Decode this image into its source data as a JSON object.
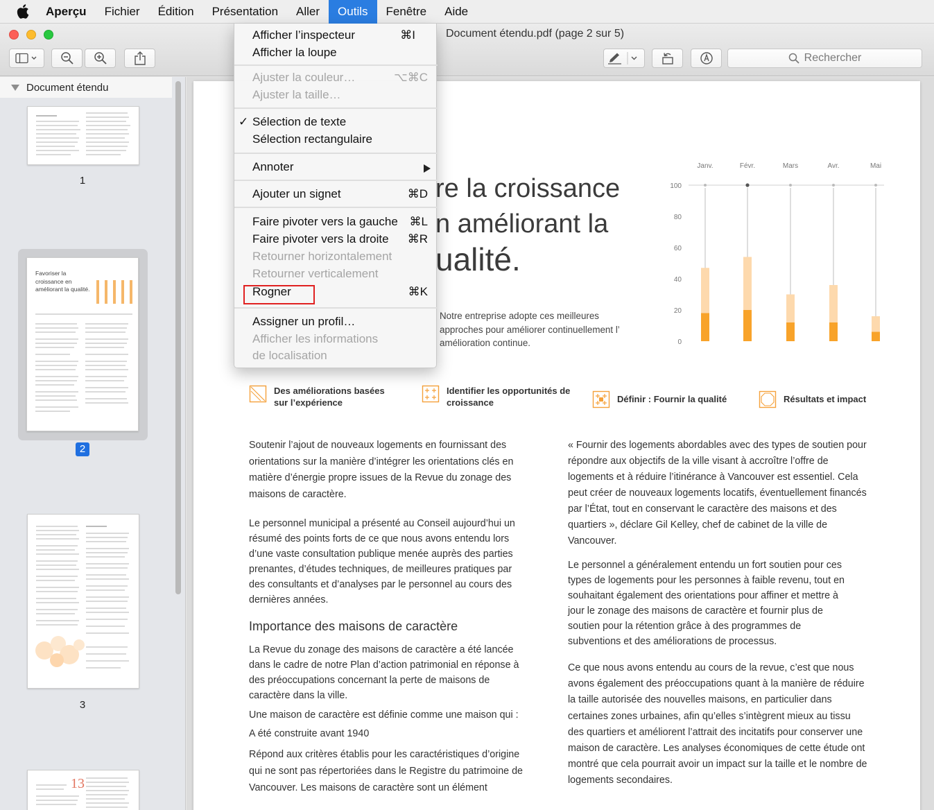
{
  "menubar": {
    "app": "Aperçu",
    "items": [
      "Fichier",
      "Édition",
      "Présentation",
      "Aller",
      "Outils",
      "Fenêtre",
      "Aide"
    ],
    "active_item": "Outils"
  },
  "window": {
    "title": "Document étendu.pdf (page 2 sur 5)",
    "search_placeholder": "Rechercher"
  },
  "sidebar": {
    "header": "Document étendu",
    "pages": [
      "1",
      "2",
      "3"
    ],
    "selected_page": "2",
    "thumb2_title": "Favoriser la croissance en améliorant la qualité.",
    "thumb4_number": "13"
  },
  "tools_menu": {
    "items": [
      {
        "label": "Afficher l’inspecteur",
        "shortcut": "⌘I"
      },
      {
        "label": "Afficher la loupe",
        "shortcut": ""
      },
      {
        "label": "Ajuster la couleur…",
        "shortcut": "⌥⌘C",
        "disabled": true
      },
      {
        "label": "Ajuster la taille…",
        "shortcut": "",
        "disabled": true
      },
      {
        "label": "Sélection de texte",
        "shortcut": "",
        "checked": true
      },
      {
        "label": "Sélection rectangulaire",
        "shortcut": ""
      },
      {
        "label": "Annoter",
        "shortcut": "",
        "submenu": true
      },
      {
        "label": "Ajouter un signet",
        "shortcut": "⌘D"
      },
      {
        "label": "Faire pivoter vers la gauche",
        "shortcut": "⌘L"
      },
      {
        "label": "Faire pivoter vers la droite",
        "shortcut": "⌘R"
      },
      {
        "label": "Retourner horizontalement",
        "shortcut": "",
        "disabled": true
      },
      {
        "label": "Retourner verticalement",
        "shortcut": "",
        "disabled": true
      },
      {
        "label": "Rogner",
        "shortcut": "⌘K",
        "highlighted": true
      },
      {
        "label": "Assigner un profil…",
        "shortcut": ""
      },
      {
        "label": "Afficher les informations",
        "shortcut": "",
        "disabled": true
      },
      {
        "label": "de localisation",
        "shortcut": "",
        "disabled": true
      }
    ],
    "checkmark": "✓"
  },
  "document": {
    "headline_lines": [
      "re la croissance",
      "n améliorant la",
      "ualité."
    ],
    "intro": "Notre entreprise adopte ces meilleures approches pour améliorer continuellement l’ amélioration continue.",
    "features": [
      {
        "label": "Des améliorations basées sur l’expérience"
      },
      {
        "label": "Identifier les opportunités de croissance"
      },
      {
        "label": "Définir : Fournir la qualité"
      },
      {
        "label": "Résultats et impact"
      }
    ],
    "left_column": {
      "p1": "Soutenir l’ajout de nouveaux logements en fournissant des orientations sur la manière d’intégrer les orientations clés en matière d’énergie propre issues de la Revue du zonage des maisons de caractère.",
      "p2": "Le personnel municipal a présenté au Conseil aujourd’hui un résumé des points forts de ce que nous avons entendu lors d’une vaste consultation publique menée auprès des parties prenantes, d’études techniques, de meilleures pratiques par des consultants et d’analyses par le personnel au cours des dernières années.",
      "heading": "Importance des maisons de caractère",
      "p3": "La Revue du zonage des maisons de caractère a été lancée dans le cadre de notre Plan d’action patrimonial en réponse à des préoccupations concernant la perte de maisons de caractère dans la ville.",
      "p4": "Une maison de caractère est définie comme une maison qui :",
      "p5": "A été construite avant 1940",
      "p6": "Répond aux critères établis pour les caractéristiques d’origine qui ne sont pas répertoriées dans le Registre du patrimoine de Vancouver. Les maisons de caractère sont un élément"
    },
    "right_column": {
      "p1": "« Fournir des logements abordables avec des types de soutien pour répondre aux objectifs de la ville visant à accroître l’offre de logements et à réduire l’itinérance à Vancouver est essentiel. Cela peut créer de nouveaux logements locatifs, éventuellement financés par l’État, tout en conservant le caractère des maisons et des quartiers », déclare Gil Kelley, chef de cabinet de la ville de Vancouver.",
      "p2": "Le personnel a généralement entendu un fort soutien pour ces types de logements pour les personnes à faible revenu, tout en souhaitant également des orientations pour affiner et mettre à jour le zonage des maisons de caractère et fournir plus de soutien pour la rétention grâce à des programmes de subventions et des améliorations de processus.",
      "p3": "Ce que nous avons entendu au cours de la revue, c’est que nous avons également des préoccupations quant à la manière de réduire la taille autorisée des nouvelles maisons, en particulier dans certaines zones urbaines, afin qu’elles s’intègrent mieux au tissu des quartiers et améliorent l’attrait des incitatifs pour conserver une maison de caractère. Les analyses économiques de cette étude ont montré que cela pourrait avoir un impact sur la taille et le nombre de logements secondaires."
    }
  },
  "colors": {
    "accent": "#2a7de1",
    "bar_light": "#fdd9ad",
    "bar_dark": "#f8a32a",
    "highlight_box": "#e02020"
  },
  "chart_data": {
    "type": "bar",
    "categories": [
      "Janv.",
      "Févr.",
      "Mars",
      "Avr.",
      "Mai"
    ],
    "series": [
      {
        "values": [
          47,
          54,
          30,
          36,
          16
        ]
      },
      {
        "values": [
          18,
          20,
          12,
          12,
          6
        ]
      }
    ],
    "stacked": false,
    "overlapped": true,
    "yticks": [
      "100",
      "80",
      "60",
      "40",
      "20",
      "0"
    ],
    "ylim": [
      0,
      100
    ],
    "xlabel": "",
    "ylabel": ""
  }
}
